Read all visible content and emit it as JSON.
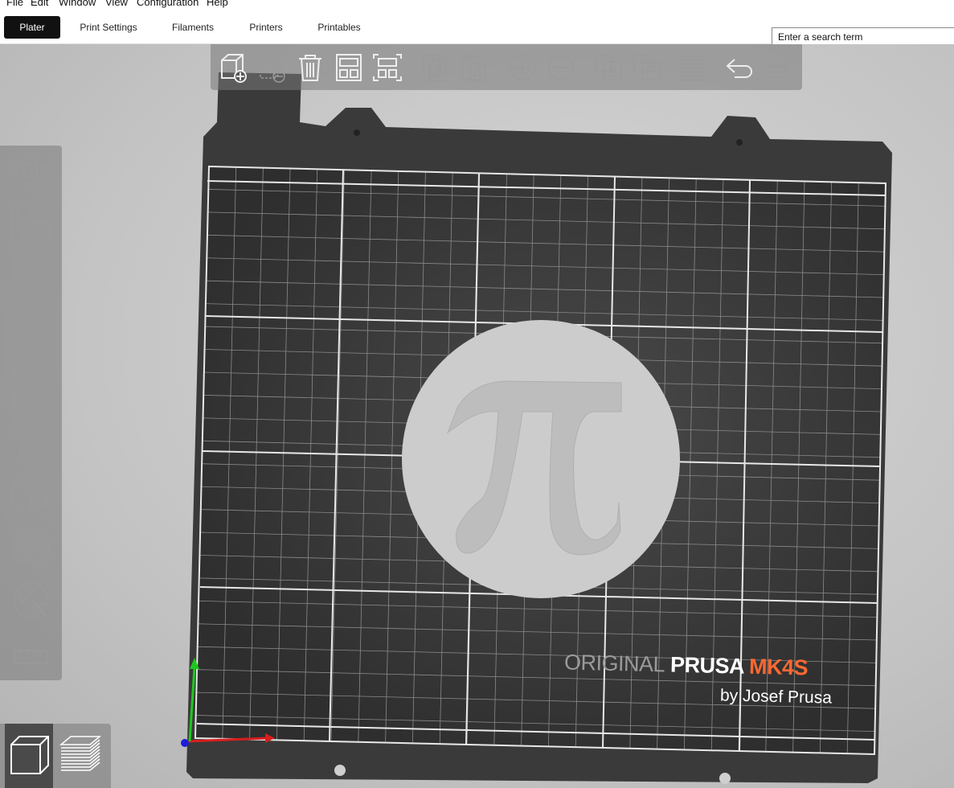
{
  "menu": {
    "items": [
      "File",
      "Edit",
      "Window",
      "View",
      "Configuration",
      "Help"
    ]
  },
  "tabs": [
    {
      "label": "Plater",
      "active": true
    },
    {
      "label": "Print Settings",
      "active": false
    },
    {
      "label": "Filaments",
      "active": false
    },
    {
      "label": "Printers",
      "active": false
    },
    {
      "label": "Printables",
      "active": false
    }
  ],
  "search": {
    "placeholder": "Enter a search term"
  },
  "bed": {
    "logo_original": "ORIGINAL",
    "logo_prusa": "PRUSA",
    "logo_model": "MK4S",
    "logo_byline": "by Josef Prusa",
    "object_symbol": "π"
  },
  "colors": {
    "accent": "#fa6831",
    "bed": "#3a3a3a",
    "toolbar": "#787878",
    "object": "#cccccc",
    "axis_x": "#d81e1e",
    "axis_y": "#1ec81e",
    "axis_z": "#1e1ed8"
  },
  "toolbar_top": [
    "add-object-icon",
    "delete-object-icon",
    "delete-all-icon",
    "arrange-icon",
    "arrange-selection-icon",
    "copy-icon",
    "paste-icon",
    "add-instance-icon",
    "remove-instance-icon",
    "split-objects-icon",
    "split-parts-icon",
    "layers-editing-icon",
    "undo-icon",
    "redo-icon"
  ],
  "toolbar_left": [
    "move-icon",
    "scale-icon",
    "rotate-icon",
    "place-on-face-icon",
    "cut-icon",
    "supports-paint-icon",
    "seam-paint-icon",
    "fuzzy-skin-icon",
    "mmu-paint-icon",
    "measure-icon"
  ],
  "view_modes": [
    "3d-view-icon",
    "preview-icon"
  ]
}
